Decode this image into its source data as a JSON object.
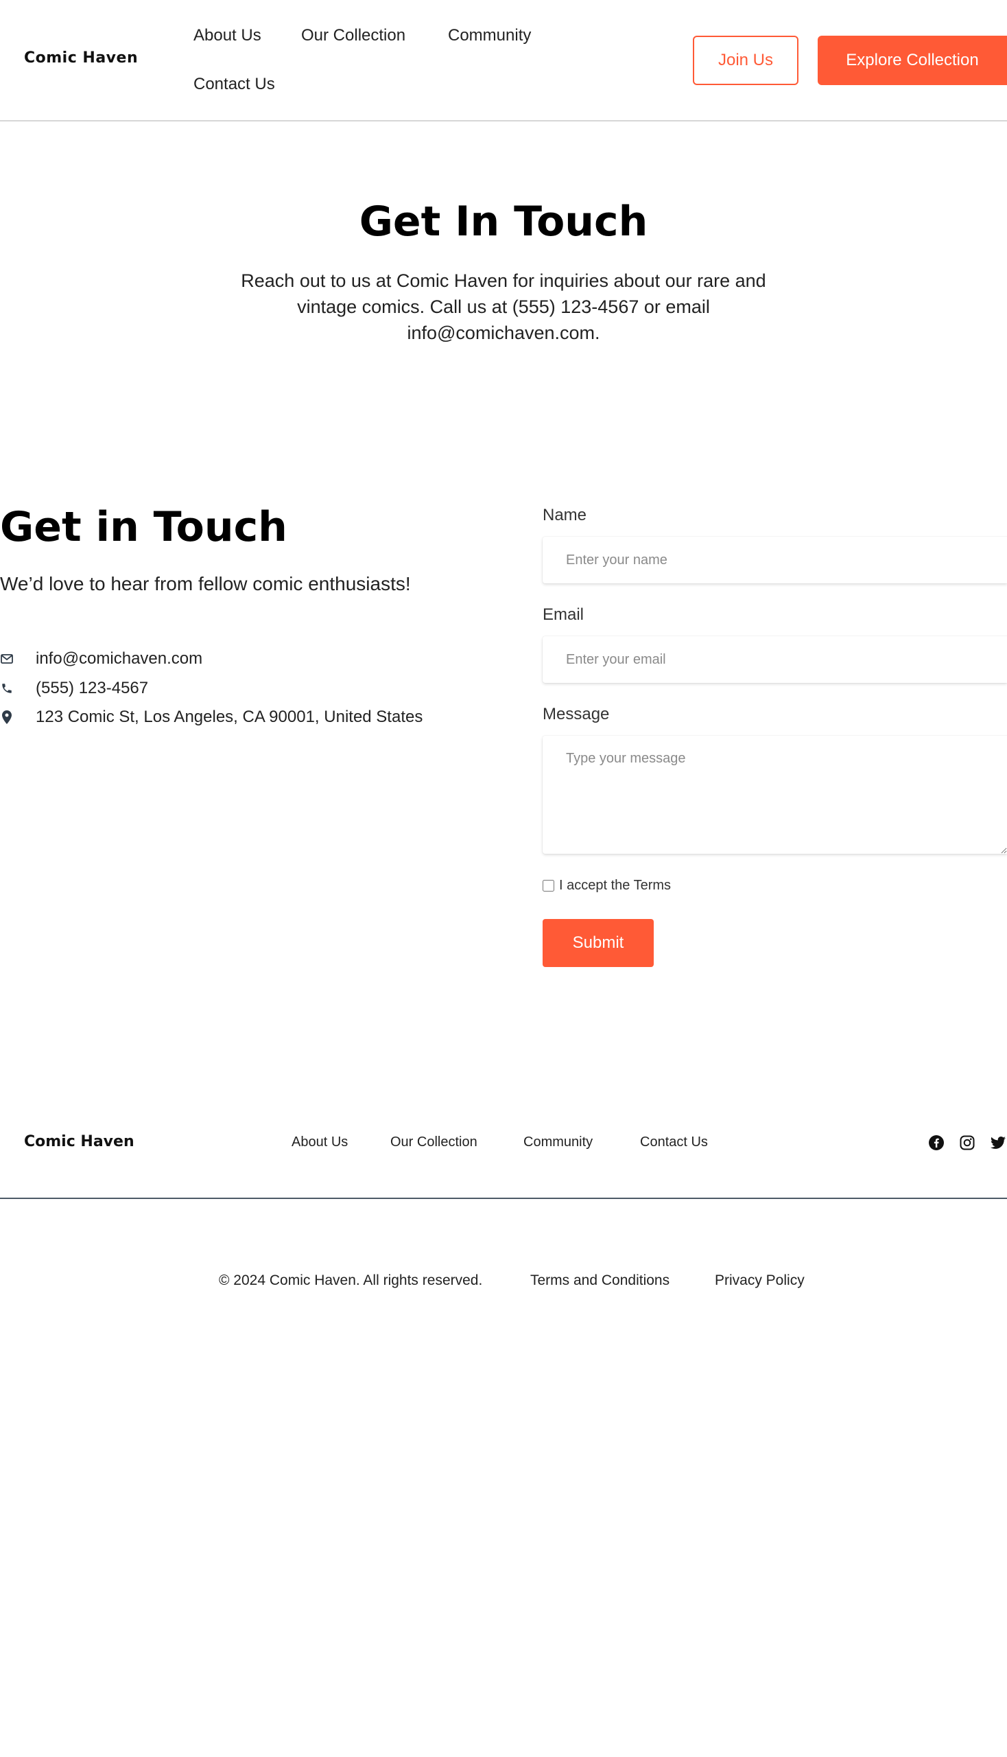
{
  "header": {
    "logo": "Comic Haven",
    "nav": [
      "About Us",
      "Our Collection",
      "Community",
      "Contact Us"
    ],
    "join_label": "Join Us",
    "explore_label": "Explore Collection"
  },
  "hero": {
    "title": "Get In Touch",
    "text": "Reach out to us at Comic Haven for inquiries about our rare and vintage comics. Call us at (555) 123-4567 or email info@comichaven.com."
  },
  "contact": {
    "title": "Get in Touch",
    "subtitle": "We’d love to hear from fellow comic enthusiasts!",
    "email": "info@comichaven.com",
    "phone": "(555) 123-4567",
    "address": "123 Comic St, Los Angeles, CA 90001, United States"
  },
  "form": {
    "name_label": "Name",
    "name_placeholder": "Enter your name",
    "email_label": "Email",
    "email_placeholder": "Enter your email",
    "message_label": "Message",
    "message_placeholder": "Type your message",
    "terms_label": "I accept the Terms",
    "submit_label": "Submit"
  },
  "footer": {
    "logo": "Comic Haven",
    "nav": [
      "About Us",
      "Our Collection",
      "Community",
      "Contact Us"
    ],
    "social_icons": [
      "facebook-icon",
      "instagram-icon",
      "twitter-icon"
    ],
    "copyright": "© 2024 Comic Haven. All rights reserved.",
    "terms": "Terms and Conditions",
    "privacy": "Privacy Policy"
  },
  "colors": {
    "accent": "#ff5a36",
    "footer_rule": "#4c5a67"
  }
}
